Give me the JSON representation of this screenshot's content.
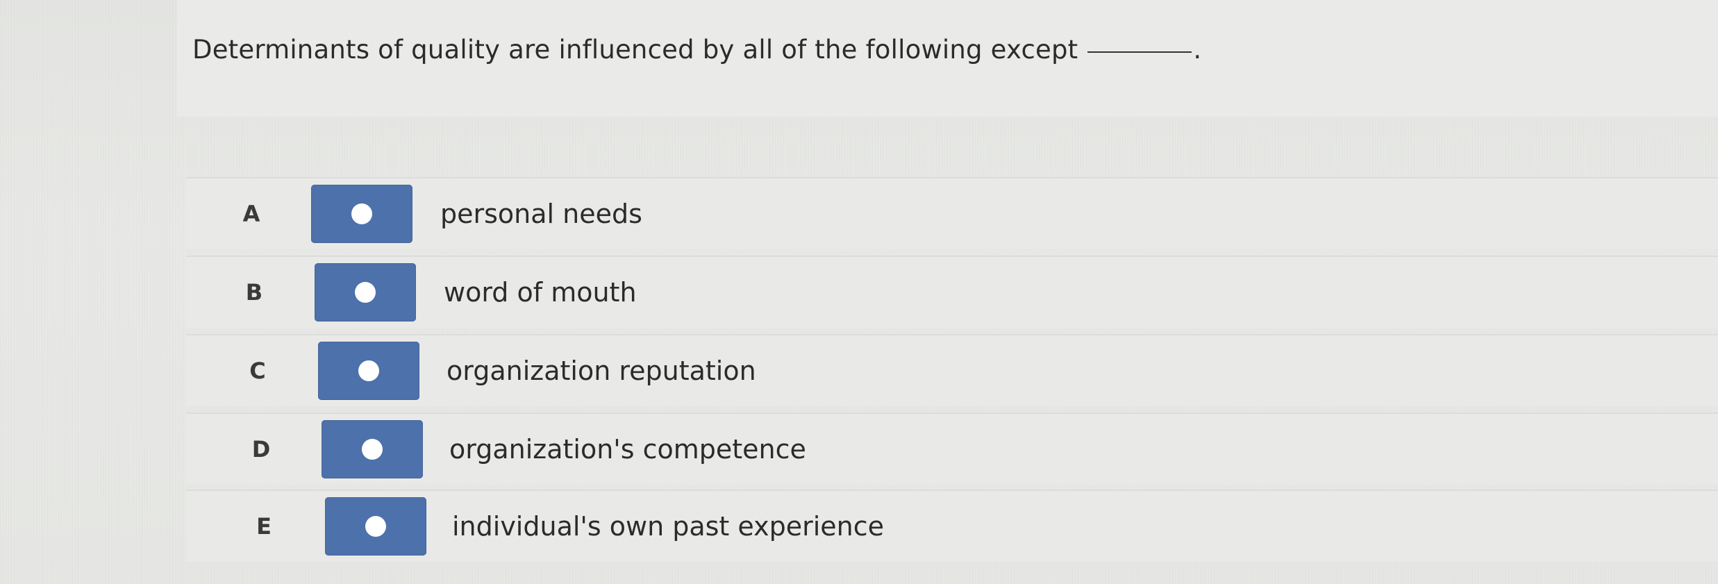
{
  "question": {
    "text": "Determinants of quality are influenced by all of the following except",
    "period": "."
  },
  "options": [
    {
      "letter": "A",
      "label": "personal needs"
    },
    {
      "letter": "B",
      "label": "word of mouth"
    },
    {
      "letter": "C",
      "label": "organization reputation"
    },
    {
      "letter": "D",
      "label": "organization's competence"
    },
    {
      "letter": "E",
      "label": "individual's own past experience"
    }
  ],
  "colors": {
    "radio_button": "#4d71ab",
    "radio_dot": "#ffffff",
    "background": "#e6e7e5"
  }
}
